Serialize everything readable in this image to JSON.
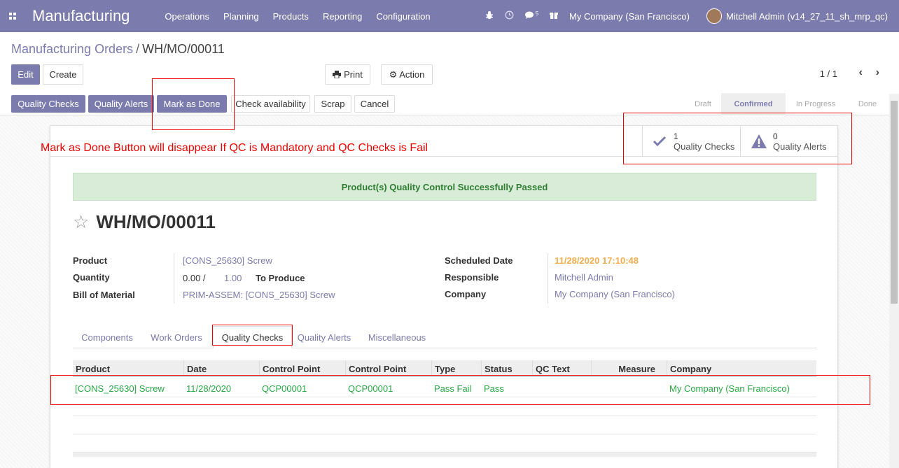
{
  "navbar": {
    "brand": "Manufacturing",
    "menu": [
      "Operations",
      "Planning",
      "Products",
      "Reporting",
      "Configuration"
    ],
    "messages_count": "5",
    "company": "My Company (San Francisco)",
    "user": "Mitchell Admin (v14_27_11_sh_mrp_qc)"
  },
  "breadcrumb": {
    "parent": "Manufacturing Orders",
    "separator": "/",
    "current": "WH/MO/00011"
  },
  "toolbar": {
    "edit": "Edit",
    "create": "Create",
    "print": "Print",
    "action": "Action"
  },
  "pager": {
    "value": "1 / 1"
  },
  "statusbar": {
    "buttons": [
      "Quality Checks",
      "Quality Alerts",
      "Mark as Done",
      "Check availability",
      "Scrap",
      "Cancel"
    ],
    "stages": [
      "Draft",
      "Confirmed",
      "In Progress",
      "Done"
    ],
    "active_stage": "Confirmed"
  },
  "annotation": "Mark as Done Button will disappear If QC is Mandatory and QC Checks is Fail",
  "smart_buttons": {
    "checks_count": "1",
    "checks_label": "Quality Checks",
    "alerts_count": "0",
    "alerts_label": "Quality Alerts"
  },
  "alert_message": "Product(s) Quality Control Successfully Passed",
  "record_title": "WH/MO/00011",
  "fields": {
    "product_label": "Product",
    "product_value": "[CONS_25630] Screw",
    "quantity_label": "Quantity",
    "quantity_done": "0.00 /",
    "quantity_total": "1.00",
    "to_produce": "To Produce",
    "bom_label": "Bill of Material",
    "bom_value": "PRIM-ASSEM: [CONS_25630] Screw",
    "scheduled_label": "Scheduled Date",
    "scheduled_value": "11/28/2020 17:10:48",
    "responsible_label": "Responsible",
    "responsible_value": "Mitchell Admin",
    "company_label": "Company",
    "company_value": "My Company (San Francisco)"
  },
  "tabs": [
    "Components",
    "Work Orders",
    "Quality Checks",
    "Quality Alerts",
    "Miscellaneous"
  ],
  "active_tab": "Quality Checks",
  "table": {
    "headers": [
      "Product",
      "Date",
      "Control Point",
      "Control Point",
      "Type",
      "Status",
      "QC Text",
      "Measure",
      "Company"
    ],
    "rows": [
      [
        "[CONS_25630] Screw",
        "11/28/2020",
        "QCP00001",
        "QCP00001",
        "Pass Fail",
        "Pass",
        "",
        "",
        "My Company (San Francisco)"
      ]
    ]
  },
  "colors": {
    "brand": "#7c7bad",
    "success": "#28a745",
    "annotation": "#ee0000",
    "warning": "#f0ad4e"
  }
}
